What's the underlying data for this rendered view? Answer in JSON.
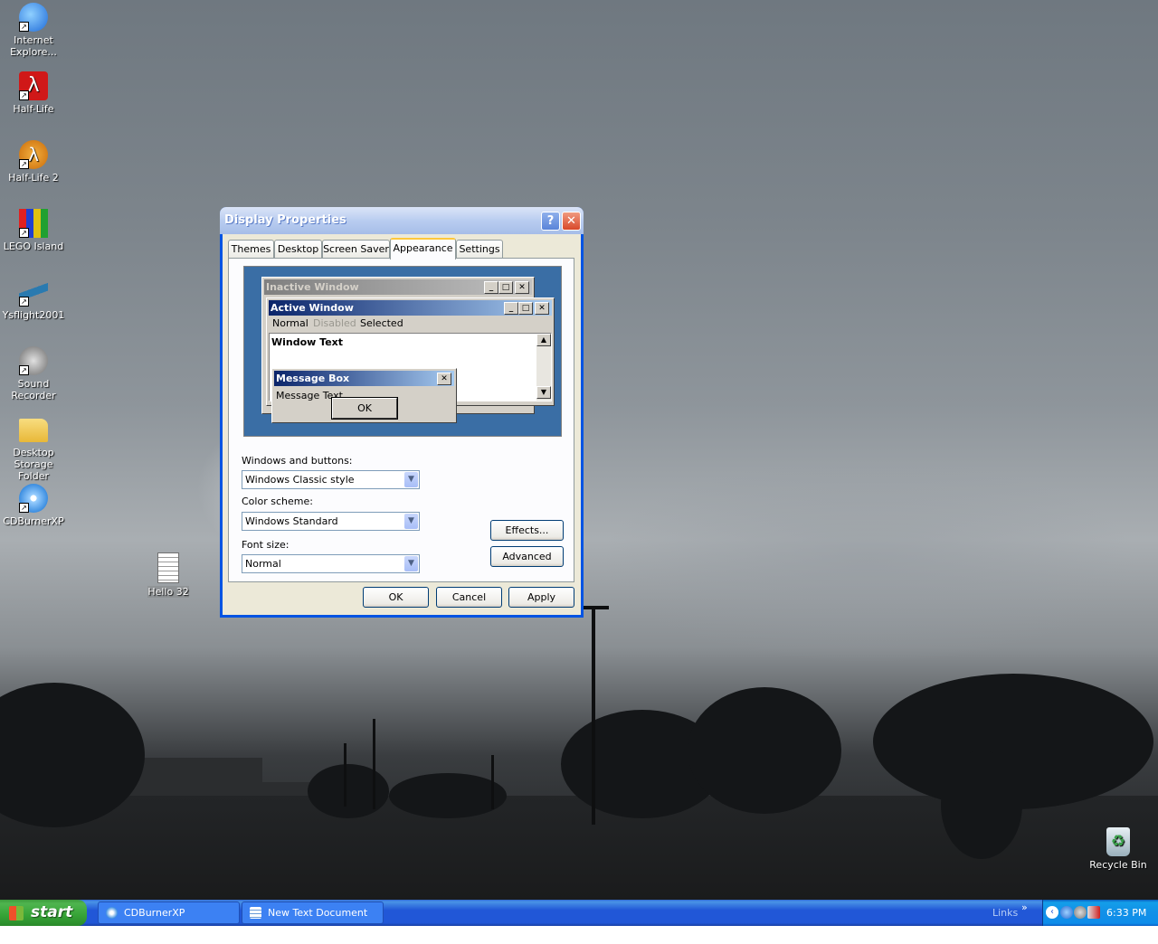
{
  "desktop_icons": [
    {
      "label": "Internet Explore...",
      "icon": "internet-explorer-icon",
      "color": "#1e6ad8"
    },
    {
      "label": "Half-Life",
      "icon": "half-life-icon",
      "color": "#d01818"
    },
    {
      "label": "Half-Life 2",
      "icon": "half-life-2-icon",
      "color": "#e88a10"
    },
    {
      "label": "LEGO Island",
      "icon": "lego-island-icon",
      "color": "#e0c010"
    },
    {
      "label": "Ysflight2001",
      "icon": "ysflight-icon",
      "color": "#2a7ab0"
    },
    {
      "label": "Sound Recorder",
      "icon": "microphone-icon",
      "color": "#8a8a8a"
    },
    {
      "label": "Desktop Storage Folder",
      "icon": "folder-icon",
      "color": "#f2cc5a"
    },
    {
      "label": "CDBurnerXP",
      "icon": "cd-icon",
      "color": "#3b8de0"
    },
    {
      "label": "Hello 32",
      "icon": "text-document-icon",
      "color": "#f4f4f4"
    },
    {
      "label": "Recycle Bin",
      "icon": "recycle-bin-icon",
      "color": "#3aa04a"
    }
  ],
  "dialog": {
    "title": "Display Properties",
    "help_glyph": "?",
    "close_glyph": "✕",
    "tabs": [
      "Themes",
      "Desktop",
      "Screen Saver",
      "Appearance",
      "Settings"
    ],
    "selected_tab": "Appearance",
    "preview": {
      "inactive_title": "Inactive Window",
      "active_title": "Active Window",
      "menu": {
        "normal": "Normal",
        "disabled": "Disabled",
        "selected": "Selected"
      },
      "window_text": "Window Text",
      "message_box_title": "Message Box",
      "message_text": "Message Text",
      "ok": "OK"
    },
    "windows_buttons_label": "Windows and buttons:",
    "windows_buttons_value": "Windows Classic style",
    "color_scheme_label": "Color scheme:",
    "color_scheme_value": "Windows Standard",
    "font_size_label": "Font size:",
    "font_size_value": "Normal",
    "effects_button": "Effects...",
    "advanced_button": "Advanced",
    "ok_button": "OK",
    "cancel_button": "Cancel",
    "apply_button": "Apply"
  },
  "taskbar": {
    "start_label": "start",
    "items": [
      {
        "label": "CDBurnerXP",
        "icon": "cd-icon"
      },
      {
        "label": "New Text Document -...",
        "icon": "notepad-icon"
      }
    ],
    "links_label": "Links",
    "links_chevron": "»",
    "clock": "6:33 PM"
  },
  "colors": {
    "xp_blue": "#0054e3",
    "start_green": "#36a336",
    "classic_gray": "#d4d0c8",
    "preview_bg": "#3a6ea5",
    "active_caption": "#0a246a",
    "inactive_caption": "#808080"
  }
}
